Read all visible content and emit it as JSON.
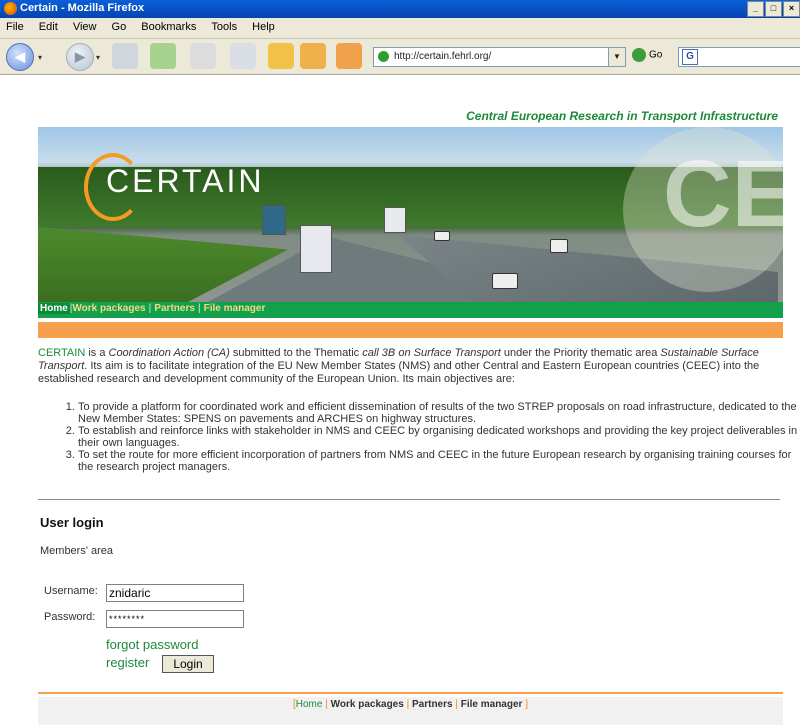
{
  "window": {
    "title": "Certain - Mozilla Firefox"
  },
  "menu": [
    "File",
    "Edit",
    "View",
    "Go",
    "Bookmarks",
    "Tools",
    "Help"
  ],
  "address": {
    "url": "http://certain.fehrl.org/",
    "go_label": "Go"
  },
  "page": {
    "tagline": "Central European Research in Transport Infrastructure",
    "logo_text": "CERTAIN",
    "nav": {
      "home": "Home",
      "work": "Work packages",
      "partners": "Partners",
      "files": "File manager",
      "sep": "|"
    },
    "intro": {
      "acronym": "CERTAIN",
      "p1": " is a ",
      "ca": "Coordination Action (CA)",
      "p2": " submitted to the Thematic ",
      "call": "call 3B on Surface Transport",
      "p3": " under the Priority thematic area ",
      "area": "Sustainable Surface Transport",
      "p4": ". Its aim is to facilitate integration of the EU New Member States (NMS) and other Central and Eastern European countries (CEEC) into the established research and development community of the European Union. Its main objectives are:"
    },
    "objectives": [
      "To provide a platform for coordinated work and efficient dissemination of results of the two STREP proposals on road infrastructure, dedicated to the New Member States: SPENS on pavements and ARCHES on highway structures.",
      "To establish and reinforce links with stakeholder in NMS and CEEC by organising dedicated workshops and providing the key project deliverables in their own languages.",
      "To set the route for more efficient incorporation of partners from NMS and CEEC in the future European research by organising training courses for the research project managers."
    ],
    "login": {
      "title": "User login",
      "members": "Members' area",
      "username_label": "Username:",
      "username_value": "znidaric",
      "password_label": "Password:",
      "password_value": "********",
      "forgot": "forgot password",
      "register": "register",
      "button": "Login"
    },
    "footer": {
      "open": "[",
      "home": "Home",
      "work": "Work packages",
      "partners": "Partners",
      "files": "File manager",
      "close": "]",
      "sep": "|"
    }
  }
}
